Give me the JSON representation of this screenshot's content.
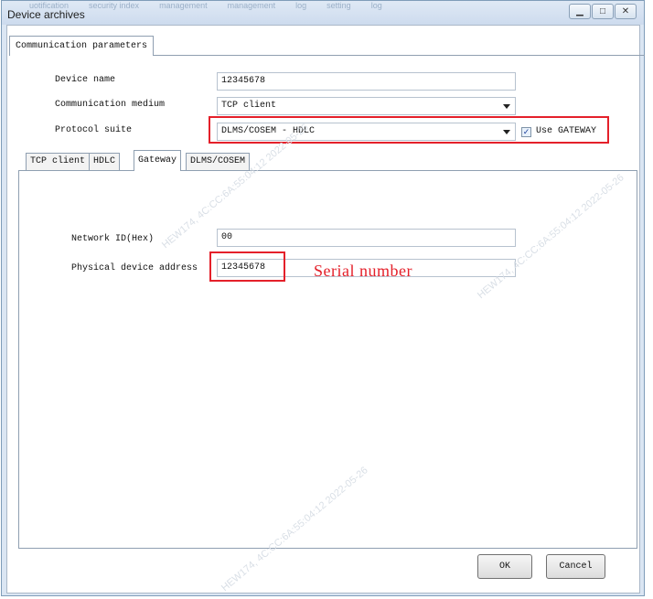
{
  "window": {
    "title": "Device archives",
    "background_tabs": [
      "uotification",
      "security index",
      "management",
      "management",
      "log",
      "setting",
      "log"
    ]
  },
  "tabs": {
    "top": [
      "Communication parameters"
    ]
  },
  "fields": {
    "device_name": {
      "label": "Device name",
      "value": "12345678"
    },
    "communication_medium": {
      "label": "Communication medium",
      "value": "TCP client"
    },
    "protocol_suite": {
      "label": "Protocol suite",
      "value": "DLMS/COSEM - HDLC"
    },
    "use_gateway": {
      "label": "Use GATEWAY",
      "checked": true
    }
  },
  "subtabs": [
    "TCP client",
    "HDLC",
    "Gateway",
    "DLMS/COSEM"
  ],
  "active_subtab": "Gateway",
  "gateway": {
    "network_id_label": "Network ID(Hex)",
    "network_id_value": "00",
    "physical_address_label": "Physical device address",
    "physical_address_value": "12345678"
  },
  "annotation": {
    "text": "Serial number",
    "color": "#e4202a"
  },
  "buttons": {
    "ok": "OK",
    "cancel": "Cancel"
  },
  "watermark": {
    "text": "HEW174, 4C:CC:6A:55:04:12  2022-05-26"
  }
}
